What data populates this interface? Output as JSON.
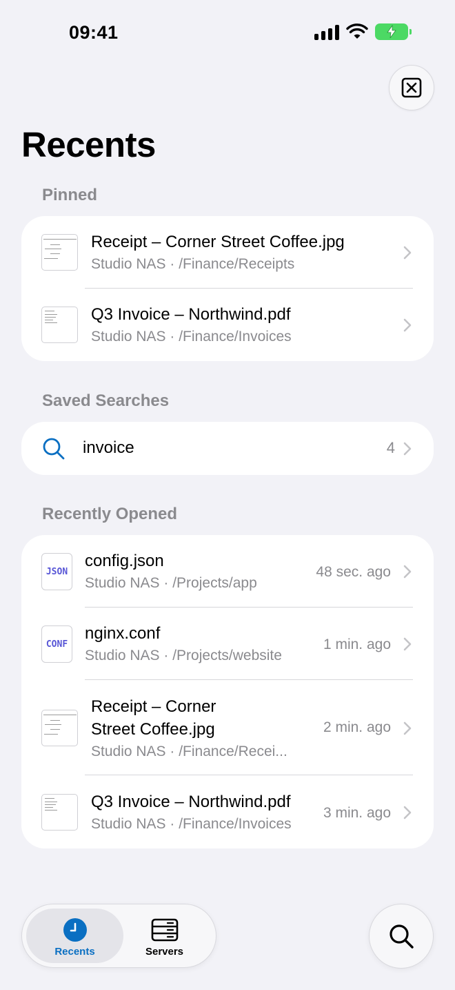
{
  "status_bar": {
    "time": "09:41"
  },
  "header": {
    "title": "Recents"
  },
  "colors": {
    "accent": "#0a6fc2",
    "battery": "#4cd964",
    "code_badge": "#5856d6"
  },
  "pinned": {
    "header": "Pinned",
    "items": [
      {
        "name": "Receipt – Corner Street Coffee.jpg",
        "path": "Studio NAS · /Finance/Receipts",
        "thumb": "receipt"
      },
      {
        "name": "Q3 Invoice – Northwind.pdf",
        "path": "Studio NAS · /Finance/Invoices",
        "thumb": "invoice"
      }
    ]
  },
  "saved_searches": {
    "header": "Saved Searches",
    "items": [
      {
        "query": "invoice",
        "count": "4",
        "icon": "search-icon"
      }
    ]
  },
  "recently_opened": {
    "header": "Recently Opened",
    "items": [
      {
        "name": "config.json",
        "path": "Studio NAS · /Projects/app",
        "time": "48 sec. ago",
        "badge": "JSON"
      },
      {
        "name": "nginx.conf",
        "path": "Studio NAS · /Projects/website",
        "time": "1 min. ago",
        "badge": "CONF"
      },
      {
        "name_line1": "Receipt – Corner",
        "name_line2": "Street Coffee.jpg",
        "path": "Studio NAS · /Finance/Recei...",
        "time": "2 min. ago",
        "thumb": "receipt"
      },
      {
        "name": "Q3 Invoice – Northwind.pdf",
        "path": "Studio NAS · /Finance/Invoices",
        "time": "3 min. ago",
        "thumb": "invoice"
      }
    ]
  },
  "tabbar": {
    "tabs": [
      {
        "label": "Recents",
        "icon": "clock-icon",
        "active": true
      },
      {
        "label": "Servers",
        "icon": "server-icon",
        "active": false
      }
    ],
    "search_icon": "search-icon"
  }
}
